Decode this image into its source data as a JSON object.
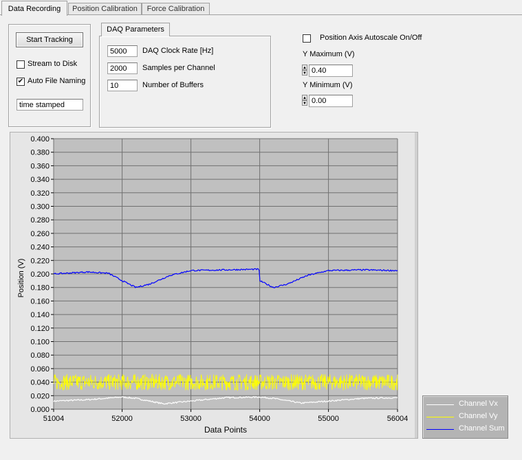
{
  "tabs": [
    {
      "label": "Data Recording"
    },
    {
      "label": "Position Calibration"
    },
    {
      "label": "Force Calibration"
    }
  ],
  "tracking": {
    "start_button": "Start Tracking",
    "stream_to_disk": {
      "label": "Stream to Disk",
      "checked": false
    },
    "auto_file_naming": {
      "label": "Auto File Naming",
      "checked": true
    },
    "file_name_value": "time stamped"
  },
  "daq": {
    "tab_label": "DAQ Parameters",
    "params": [
      {
        "value": "5000",
        "label": "DAQ Clock Rate [Hz]"
      },
      {
        "value": "2000",
        "label": "Samples per Channel"
      },
      {
        "value": "10",
        "label": "Number of Buffers"
      }
    ]
  },
  "axis_controls": {
    "autoscale": {
      "label": "Position Axis Autoscale On/Off",
      "checked": false
    },
    "ymax_label": "Y Maximum (V)",
    "ymax_value": "0.40",
    "ymin_label": "Y Minimum (V)",
    "ymin_value": "0.00"
  },
  "colors": {
    "plot_bg": "#c0c0c0",
    "grid": "#707070",
    "vx": "#ffffff",
    "vy": "#ffff00",
    "sum": "#0000ff",
    "legend_bg": "#b4b4b4"
  },
  "chart_data": {
    "type": "line",
    "xlabel": "Data Points",
    "ylabel": "Position (V)",
    "xlim": [
      51004,
      56004
    ],
    "ylim": [
      0.0,
      0.4
    ],
    "x_ticks": [
      "51004",
      "52000",
      "53000",
      "54000",
      "55000",
      "56004"
    ],
    "y_ticks": [
      "0.000",
      "0.020",
      "0.040",
      "0.060",
      "0.080",
      "0.100",
      "0.120",
      "0.140",
      "0.160",
      "0.180",
      "0.200",
      "0.220",
      "0.240",
      "0.260",
      "0.280",
      "0.300",
      "0.320",
      "0.340",
      "0.360",
      "0.380",
      "0.400"
    ],
    "grid": true,
    "legend_position": "right-bottom",
    "series": [
      {
        "name": "Channel Vx",
        "color": "#ffffff",
        "x": [
          51004,
          51500,
          52000,
          52200,
          52600,
          53000,
          53500,
          54000,
          54200,
          54600,
          55000,
          55500,
          56004
        ],
        "y": [
          0.012,
          0.014,
          0.018,
          0.016,
          0.008,
          0.012,
          0.017,
          0.018,
          0.016,
          0.009,
          0.012,
          0.016,
          0.017
        ]
      },
      {
        "name": "Channel Vy",
        "color": "#ffff00",
        "x": [
          51004,
          52000,
          53000,
          54000,
          55000,
          56004
        ],
        "y": [
          0.04,
          0.04,
          0.04,
          0.04,
          0.04,
          0.04
        ],
        "noise": 0.012
      },
      {
        "name": "Channel Sum",
        "color": "#0000ff",
        "x": [
          51004,
          51500,
          51800,
          52000,
          52200,
          52400,
          52700,
          53000,
          53500,
          53990,
          54000,
          54200,
          54400,
          54700,
          55000,
          55500,
          56004
        ],
        "y": [
          0.2,
          0.203,
          0.201,
          0.19,
          0.18,
          0.185,
          0.198,
          0.205,
          0.206,
          0.207,
          0.19,
          0.18,
          0.185,
          0.198,
          0.205,
          0.206,
          0.205
        ]
      }
    ]
  }
}
